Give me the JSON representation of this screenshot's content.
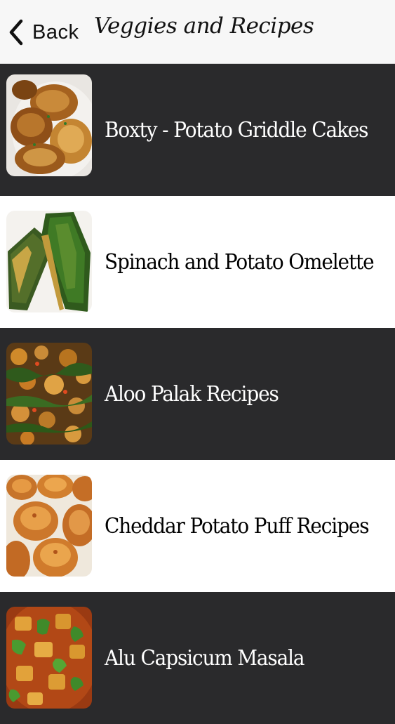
{
  "navbar": {
    "back_label": "Back",
    "back_icon": "chevron-left-icon",
    "title": "Veggies and Recipes"
  },
  "recipes": [
    {
      "label": "Boxty - Potato Griddle Cakes",
      "theme": "dark",
      "thumb": "potato-griddle-cakes-photo"
    },
    {
      "label": "Spinach and Potato Omelette",
      "theme": "light",
      "thumb": "spinach-omelette-photo"
    },
    {
      "label": "Aloo Palak Recipes",
      "theme": "dark",
      "thumb": "aloo-palak-photo"
    },
    {
      "label": "Cheddar Potato Puff Recipes",
      "theme": "light",
      "thumb": "cheddar-potato-puff-photo"
    },
    {
      "label": "Alu Capsicum Masala",
      "theme": "dark",
      "thumb": "alu-capsicum-masala-photo"
    }
  ],
  "colors": {
    "navbar_bg": "#f7f7f7",
    "dark_row": "#2a2a2c",
    "light_row": "#ffffff"
  }
}
